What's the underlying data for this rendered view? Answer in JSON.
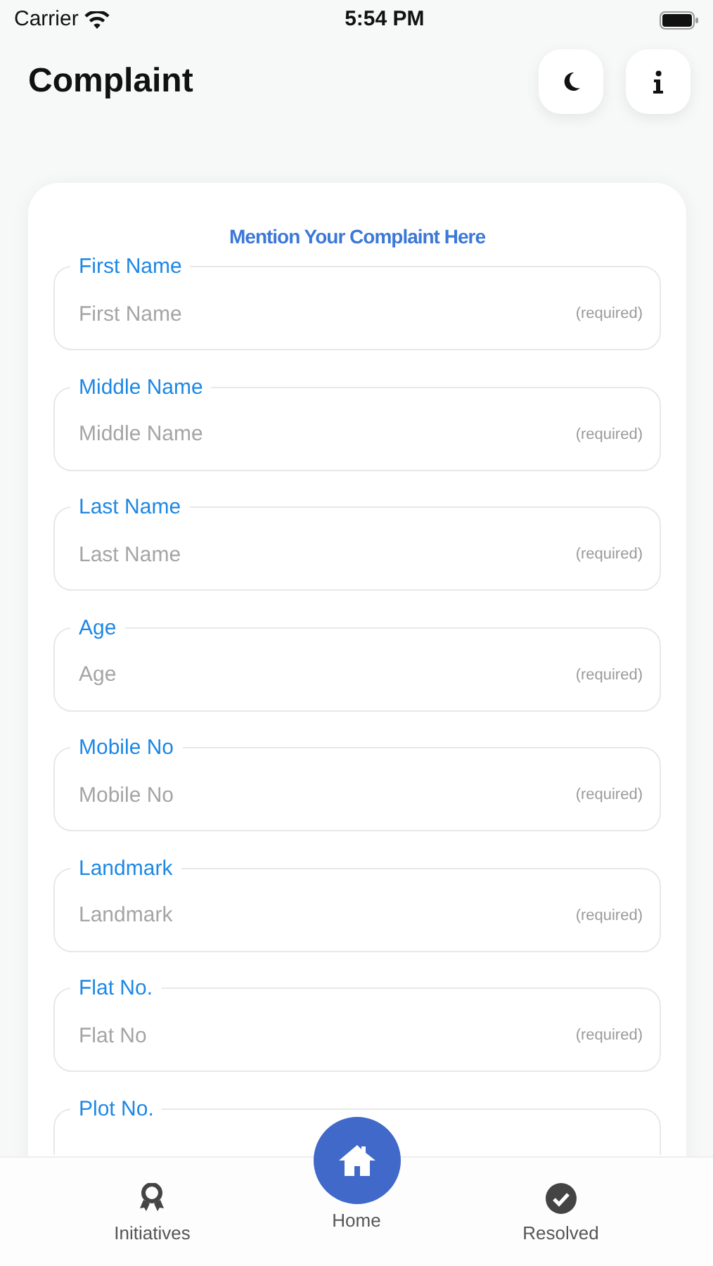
{
  "status_bar": {
    "carrier": "Carrier",
    "time": "5:54 PM"
  },
  "header": {
    "title": "Complaint",
    "buttons": [
      {
        "kind": "theme"
      },
      {
        "kind": "info"
      }
    ]
  },
  "form": {
    "heading": "Mention Your Complaint Here",
    "fields": [
      {
        "label": "First Name",
        "placeholder": "First Name",
        "hint": "(required)"
      },
      {
        "label": "Middle Name",
        "placeholder": "Middle Name",
        "hint": "(required)"
      },
      {
        "label": "Last Name",
        "placeholder": "Last Name",
        "hint": "(required)"
      },
      {
        "label": "Age",
        "placeholder": "Age",
        "hint": "(required)"
      },
      {
        "label": "Mobile No",
        "placeholder": "Mobile No",
        "hint": "(required)"
      },
      {
        "label": "Landmark",
        "placeholder": "Landmark",
        "hint": "(required)"
      },
      {
        "label": "Flat No.",
        "placeholder": "Flat No",
        "hint": "(required)"
      },
      {
        "label": "Plot No."
      }
    ]
  },
  "tab_bar": {
    "items": [
      {
        "label": "Initiatives",
        "selected": false
      },
      {
        "label": "Home",
        "selected": true
      },
      {
        "label": "Resolved",
        "selected": false
      }
    ]
  }
}
